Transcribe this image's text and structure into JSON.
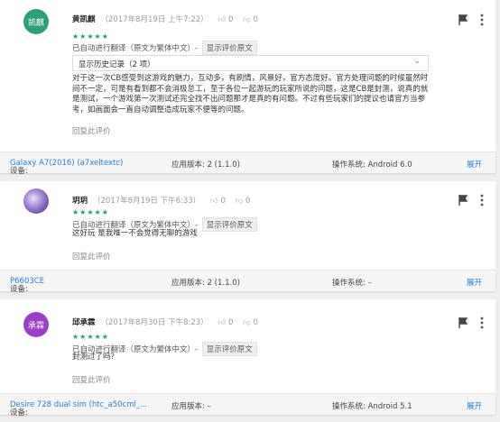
{
  "reviews": [
    {
      "avatar_text": "凯麒",
      "avatar_color": "#2f9e7a",
      "name": "黄凯麒",
      "date": "（2017年8月19日 上午7:22）",
      "thumbs_up": "0",
      "thumbs_down": "0",
      "stars": "★★★★★",
      "translation_note": "已自动进行翻译（原文为繁体中文）-",
      "show_original": "显示评价原文",
      "history_label": "显示历史记录（2 项）",
      "text": "对于这一次CB感受到这游戏的魅力，互动多，有刷情，风景好，官方态度好。官方处理问题的时候虽然时间不一定，可是有看到都不会消极怠工，至于各位一起游玩的玩家所说的问题，这是CB是封测，说真的就是测试，一个游戏第一次测试还完全找不出问题那才是真的有问题。不过有些玩家们的提议也请官方当参考，如画面会一直自动调整造成玩家不便等的问题。",
      "reply": "回复此评价",
      "device_label": "设备:",
      "device": "Galaxy A7(2016) (a7xeltextc)",
      "app_version": "应用版本: 2 (1.1.0)",
      "os": "操作系统: Android 6.0",
      "expand": "展开"
    },
    {
      "avatar_text": "",
      "avatar_color": "#6a4fa8",
      "name": "玥玥",
      "date": "（2017年8月19日 下午6:33）",
      "thumbs_up": "0",
      "thumbs_down": "0",
      "stars": "★★★★★",
      "translation_note": "已自动进行翻译（原文为繁体中文）-",
      "show_original": "显示评价原文",
      "text": "这好玩 是我唯一不会觉得无聊的游戏",
      "reply": "回复此评价",
      "device_label": "设备:",
      "device": "P6603CE",
      "app_version": "应用版本: 2 (1.1.0)",
      "os": "操作系统: –",
      "expand": "展开"
    },
    {
      "avatar_text": "承霖",
      "avatar_color": "#9c3fc7",
      "name": "邱承霖",
      "date": "（2017年8月30日 下午8:23）",
      "thumbs_up": "0",
      "thumbs_down": "0",
      "stars": "★★★★★",
      "translation_note": "已自动进行翻译（原文为繁体中文）-",
      "show_original": "显示评价原文",
      "text": "封测过了吗？",
      "reply": "回复此评价",
      "device_label": "设备:",
      "device": "Desire 728 dual sim (htc_a50cml_...",
      "app_version": "应用版本: –",
      "os": "操作系统: Android 5.1",
      "expand": "展开"
    }
  ]
}
